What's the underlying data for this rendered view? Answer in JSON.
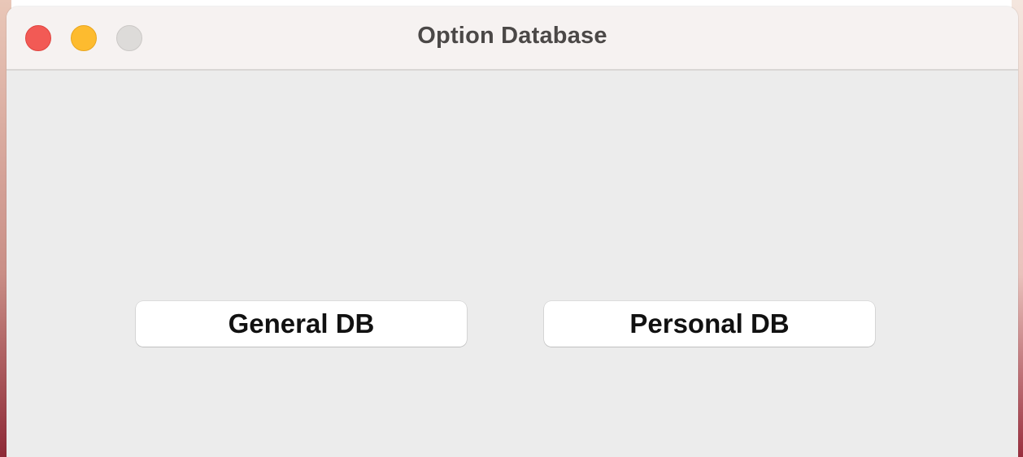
{
  "window": {
    "title": "Option Database",
    "controls": [
      "close-button",
      "minimize-button",
      "zoom-button"
    ]
  },
  "buttons": {
    "general": "General DB",
    "personal": "Personal DB"
  },
  "colors": {
    "close": "#f25a55",
    "minimize": "#fdbb2f",
    "zoom": "#dddbd9",
    "window_bg": "#ececec",
    "titlebar_bg": "#f6f2f1"
  }
}
